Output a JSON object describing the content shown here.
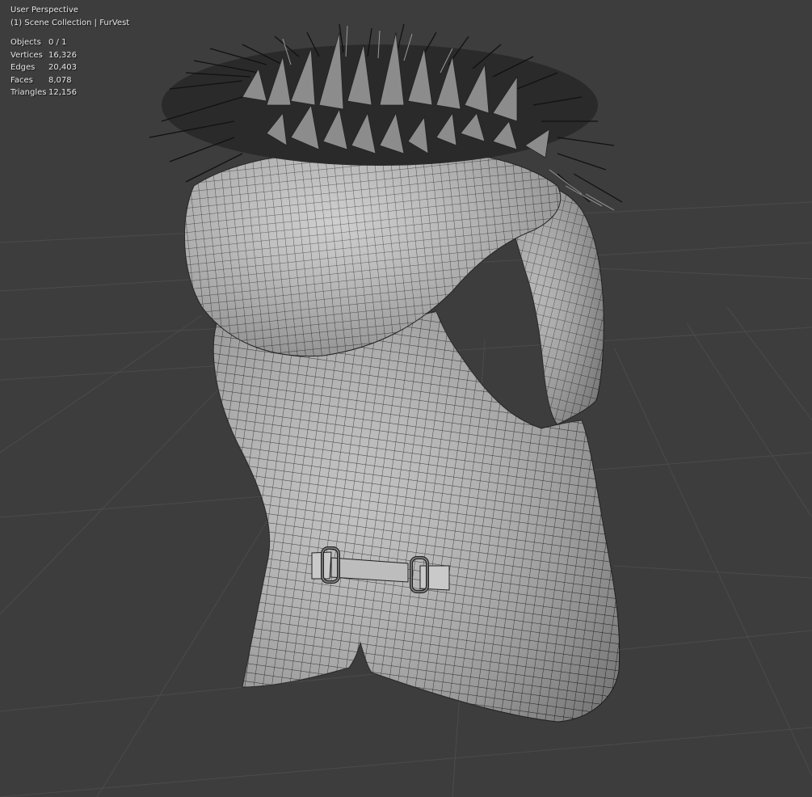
{
  "viewport": {
    "view_name": "User Perspective",
    "collection_line": "(1) Scene Collection | FurVest",
    "background_color": "#3d3d3d",
    "grid_color": "#4a4a4a",
    "mesh_color": "#a8a8a8",
    "wire_color": "#1a1a1a",
    "fur_color": "#262626"
  },
  "stats": [
    {
      "label": "Objects",
      "value": "0 / 1"
    },
    {
      "label": "Vertices",
      "value": "16,326"
    },
    {
      "label": "Edges",
      "value": "20,403"
    },
    {
      "label": "Faces",
      "value": "8,078"
    },
    {
      "label": "Triangles",
      "value": "12,156"
    }
  ],
  "object": {
    "name": "FurVest",
    "mode": "wireframe-overlay"
  }
}
